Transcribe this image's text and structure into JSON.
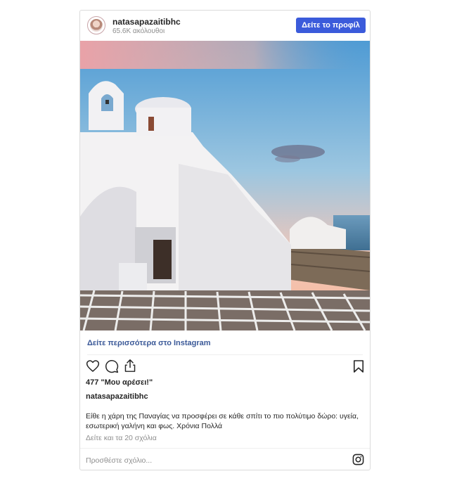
{
  "post": {
    "username": "natasapazaitibhc",
    "followers": "65.6K ακόλουθοι",
    "profile_button": "Δείτε το προφίλ",
    "see_more": "Δείτε περισσότερα στο Instagram",
    "likes": "477 \"Μου αρέσει!\"",
    "owner": "natasapazaitibhc",
    "caption": "Είθε η χάρη της Παναγίας να προσφέρει σε κάθε σπίτι το πιο πολύτιμο δώρο: υγεία, εσωτερική γαλήνη και φως. Χρόνια Πολλά",
    "view_comments": "Δείτε και τα 20 σχόλια",
    "add_comment_placeholder": "Προσθέστε σχόλιο..."
  },
  "icons": [
    "heart-icon",
    "comment-icon",
    "share-icon",
    "bookmark-icon",
    "instagram-logo-icon"
  ],
  "colors": {
    "button": "#3b5bdb",
    "link": "#3b5998",
    "muted": "#8e8e8e"
  }
}
